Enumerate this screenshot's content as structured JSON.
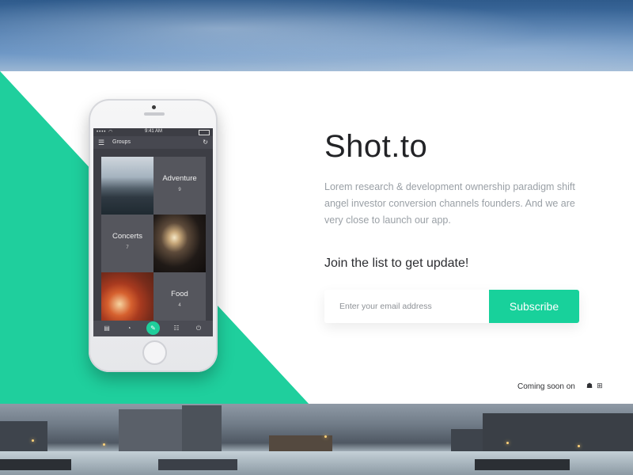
{
  "brand": {
    "name": "Shot.to",
    "description": "Lorem research & development ownership paradigm shift angel investor conversion channels founders. And we are very close to launch our app."
  },
  "signup": {
    "heading": "Join the list to get update!",
    "email_placeholder": "Enter your email address",
    "subscribe_label": "Subscribe"
  },
  "footer": {
    "coming_soon": "Coming soon on",
    "platform_icons": [
      "apple-icon",
      "android-icon",
      "windows-icon"
    ]
  },
  "phone": {
    "status_time": "9:41 AM",
    "app_title": "Groups",
    "tiles": [
      {
        "label": "Adventure",
        "count": "9"
      },
      {
        "label": "Concerts",
        "count": "7"
      },
      {
        "label": "Food",
        "count": "4"
      }
    ]
  },
  "colors": {
    "accent": "#18d19b",
    "teal_bg": "#1fcf9d",
    "text_dark": "#222326",
    "text_muted": "#9aa0a6"
  }
}
